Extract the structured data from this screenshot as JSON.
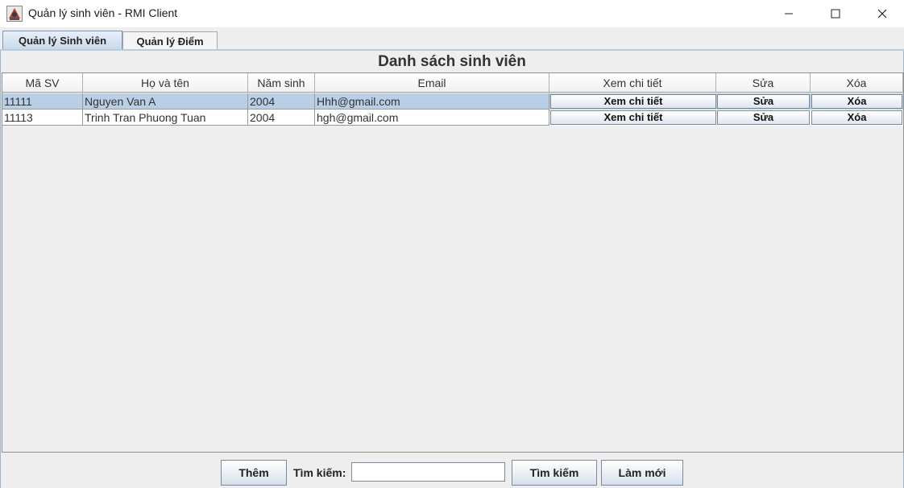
{
  "window": {
    "title": "Quản lý sinh viên - RMI Client"
  },
  "tabs": [
    {
      "label": "Quản lý Sinh viên",
      "active": true
    },
    {
      "label": "Quản lý Điểm",
      "active": false
    }
  ],
  "list_title": "Danh sách sinh viên",
  "table": {
    "columns": [
      "Mã SV",
      "Họ và tên",
      "Năm sinh",
      "Email",
      "Xem chi tiết",
      "Sửa",
      "Xóa"
    ],
    "rows": [
      {
        "ma_sv": "11111",
        "ho_ten": "Nguyen Van A",
        "nam_sinh": "2004",
        "email": "Hhh@gmail.com",
        "detail": "Xem chi tiết",
        "edit": "Sửa",
        "delete": "Xóa",
        "selected": true
      },
      {
        "ma_sv": "11113",
        "ho_ten": "Trinh Tran Phuong Tuan",
        "nam_sinh": "2004",
        "email": "hgh@gmail.com",
        "detail": "Xem chi tiết",
        "edit": "Sửa",
        "delete": "Xóa",
        "selected": false
      }
    ]
  },
  "toolbar": {
    "add_label": "Thêm",
    "search_label": "Tìm kiếm:",
    "search_value": "",
    "search_button_label": "Tìm kiếm",
    "refresh_label": "Làm mới"
  },
  "colors": {
    "selected_row": "#b8cfe5",
    "panel_bg": "#eeeeee",
    "tab_active": "#c8d8ea"
  }
}
